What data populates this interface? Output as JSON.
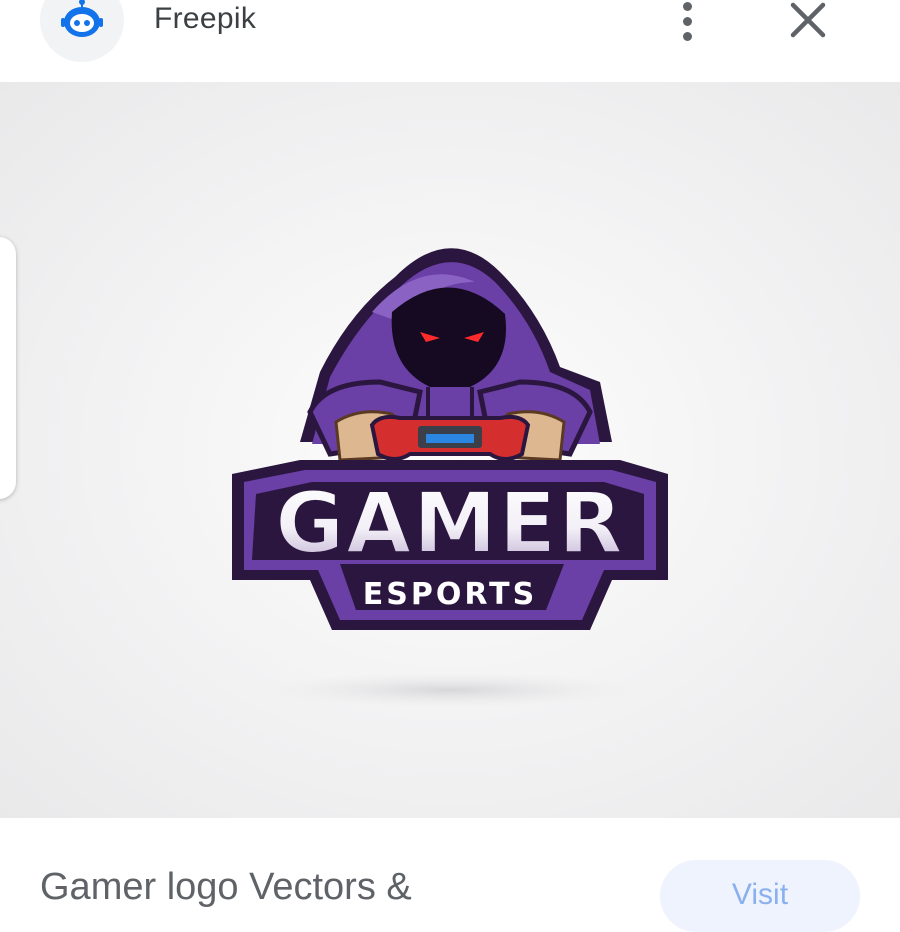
{
  "header": {
    "source_name": "Freepik",
    "source_icon": "freepik-robot-icon",
    "more_icon": "more-vert-icon",
    "close_icon": "close-icon"
  },
  "image": {
    "logo_title": "GAMER",
    "logo_subtitle": "ESPORTS",
    "colors": {
      "purple": "#6a3fa6",
      "dark_purple": "#2b163f",
      "eyes": "#ff2a2a",
      "controller": "#d42e2e",
      "skin": "#dcb78f"
    }
  },
  "result": {
    "title": "Gamer logo Vectors &",
    "visit_label": "Visit"
  }
}
